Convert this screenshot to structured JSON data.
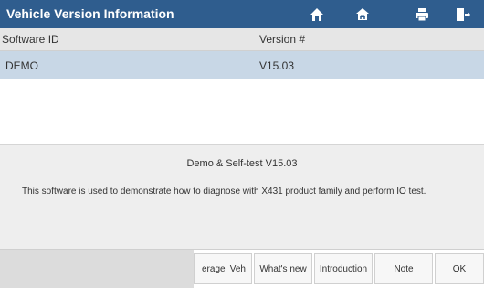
{
  "header": {
    "title": "Vehicle Version Information",
    "icons": [
      "home-icon",
      "vehicle-home-icon",
      "print-icon",
      "exit-icon"
    ]
  },
  "table": {
    "columns": [
      "Software ID",
      "Version #"
    ],
    "rows": [
      [
        "DEMO",
        "V15.03"
      ]
    ]
  },
  "info": {
    "heading": "Demo & Self-test V15.03",
    "description": "This software is used to demonstrate how to diagnose with X431 product family and perform IO test."
  },
  "buttons": {
    "coverage_partial": [
      "erage",
      "Veh"
    ],
    "whats_new": "What's new",
    "introduction": "Introduction",
    "note": "Note",
    "ok": "OK"
  },
  "colors": {
    "titlebar": "#2f5d8e",
    "selected_row": "#c8d7e6",
    "header_row": "#e6e6e6"
  }
}
